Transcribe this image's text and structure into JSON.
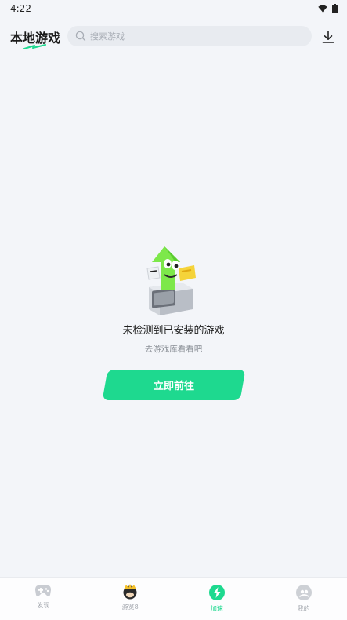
{
  "status_bar": {
    "time": "4:22"
  },
  "header": {
    "title": "本地游戏",
    "search_placeholder": "搜索游戏"
  },
  "empty_state": {
    "title": "未检测到已安装的游戏",
    "subtitle": "去游戏库看看吧",
    "button_label": "立即前往"
  },
  "bottom_nav": {
    "tabs": [
      {
        "label": "发现",
        "icon": "gamepad-icon",
        "active": false
      },
      {
        "label": "游览8",
        "icon": "avatar-icon",
        "active": false
      },
      {
        "label": "加速",
        "icon": "lightning-icon",
        "active": true
      },
      {
        "label": "我的",
        "icon": "profile-icon",
        "active": false
      }
    ]
  },
  "colors": {
    "accent": "#1ed98f",
    "background": "#f3f5f9",
    "inactive": "#a2a6ad"
  }
}
